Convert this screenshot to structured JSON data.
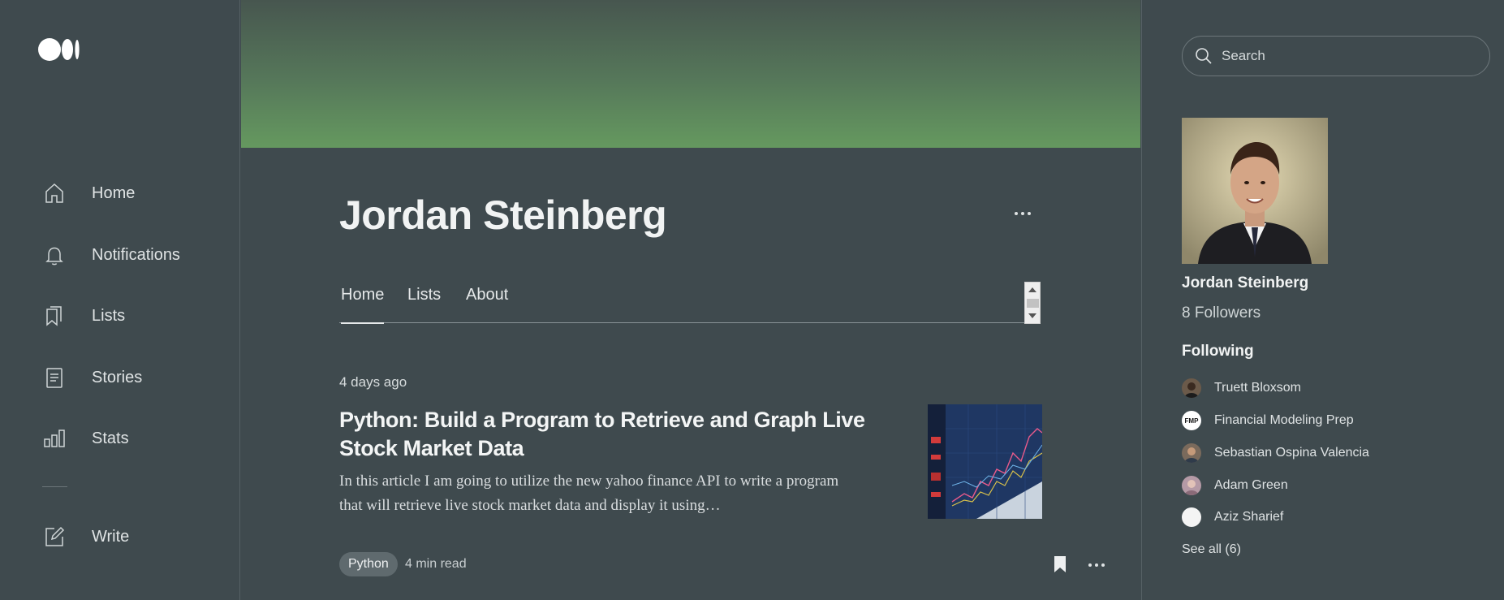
{
  "nav": {
    "items": [
      {
        "label": "Home",
        "icon": "home-icon"
      },
      {
        "label": "Notifications",
        "icon": "bell-icon"
      },
      {
        "label": "Lists",
        "icon": "bookmarks-icon"
      },
      {
        "label": "Stories",
        "icon": "document-icon"
      },
      {
        "label": "Stats",
        "icon": "bar-chart-icon"
      }
    ],
    "write": {
      "label": "Write",
      "icon": "pencil-icon"
    }
  },
  "profile": {
    "name": "Jordan Steinberg",
    "banner_colors": [
      "#47564f",
      "#65995f"
    ],
    "tabs": [
      {
        "label": "Home",
        "active": true
      },
      {
        "label": "Lists",
        "active": false
      },
      {
        "label": "About",
        "active": false
      }
    ]
  },
  "article": {
    "date": "4 days ago",
    "title": "Python: Build a Program to Retrieve and Graph Live Stock Market Data",
    "excerpt": "In this article I am going to utilize the new yahoo finance API to write a program that will retrieve live stock market data and display it using…",
    "tag": "Python",
    "read_time": "4 min read"
  },
  "sidebar": {
    "search_placeholder": "Search",
    "name": "Jordan Steinberg",
    "followers": "8 Followers",
    "following_heading": "Following",
    "following": [
      {
        "name": "Truett Bloxsom"
      },
      {
        "name": "Financial Modeling Prep",
        "avatar_text": "FMP"
      },
      {
        "name": "Sebastian Ospina Valencia"
      },
      {
        "name": "Adam Green"
      },
      {
        "name": "Aziz Sharief"
      }
    ],
    "see_all": "See all (6)"
  },
  "colors": {
    "background": "#3f4a4e",
    "text": "#e6e9ea"
  }
}
